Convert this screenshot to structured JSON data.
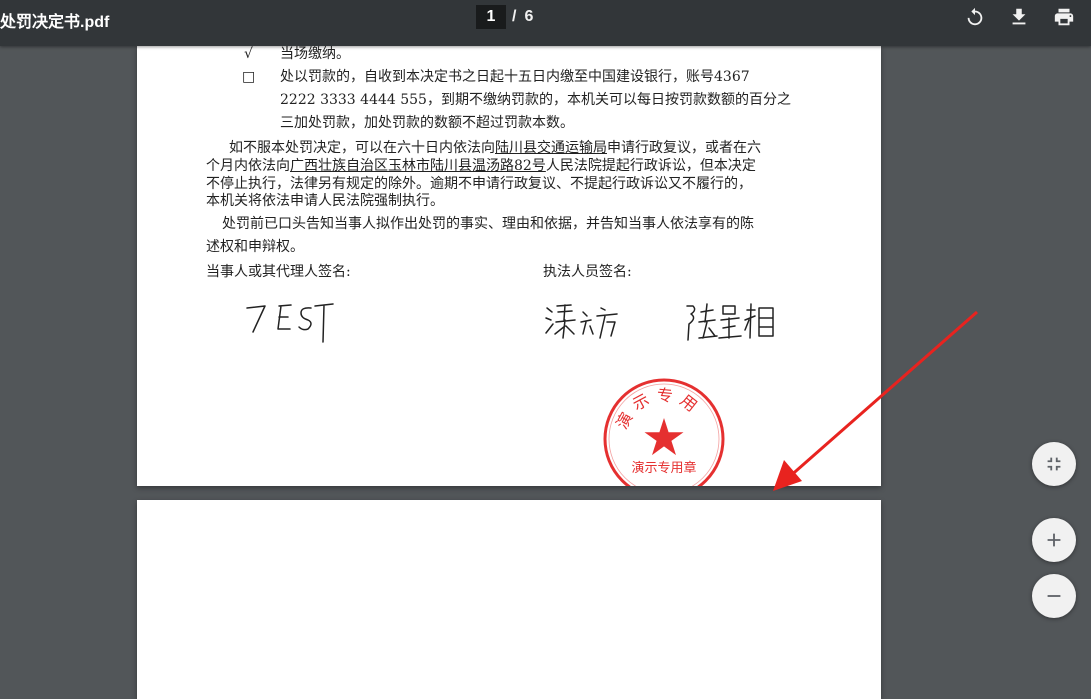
{
  "toolbar": {
    "title": "处罚决定书.pdf",
    "current_page": "1",
    "page_separator": "/",
    "total_pages": "6",
    "icons": [
      "rotate-icon",
      "download-icon",
      "print-icon"
    ]
  },
  "document": {
    "line_check_mark": "√",
    "line_check_text": "当场缴纳。",
    "line_box_mark": "□",
    "line_box_text_1": "处以罚款的，自收到本决定书之日起十五日内缴至中国建设银行，账号4367",
    "line_box_text_2": "2222 3333 4444 555，到期不缴纳罚款的，本机关可以每日按罚款数额的百分之",
    "line_box_text_3": "三加处罚款，加处罚款的数额不超过罚款本数。",
    "appeal_1a": "如不服本处罚决定，可以在六十日内依法向",
    "appeal_1b": "陆川县交通运输局",
    "appeal_1c": "申请行政复议，或者在六",
    "appeal_2a": "个月内依法向",
    "appeal_2b": "广西壮族自治区玉林市陆川县温汤路82号",
    "appeal_2c": "人民法院提起行政诉讼，但本决定",
    "appeal_3": "不停止执行，法律另有规定的除外。逾期不申请行政复议、不提起行政诉讼又不履行的，",
    "appeal_4": "本机关将依法申请人民法院强制执行。",
    "notice_1": "处罚前已口头告知当事人拟作出处罚的事实、理由和依据，并告知当事人依法享有的陈",
    "notice_2": "述权和申辩权。",
    "party_sign_label": "当事人或其代理人签名:",
    "officer_sign_label": "执法人员签名:",
    "seal_top_text": "演示专用",
    "seal_bottom_text": "演示专用章"
  },
  "controls": {
    "fit_icon": "fit-page-icon",
    "zoom_in_icon": "zoom-in-icon",
    "zoom_out_icon": "zoom-out-icon"
  },
  "colors": {
    "toolbar": "#323639",
    "viewer_bg": "#525659",
    "seal_red": "#e53030",
    "arrow_red": "#e8231f"
  }
}
